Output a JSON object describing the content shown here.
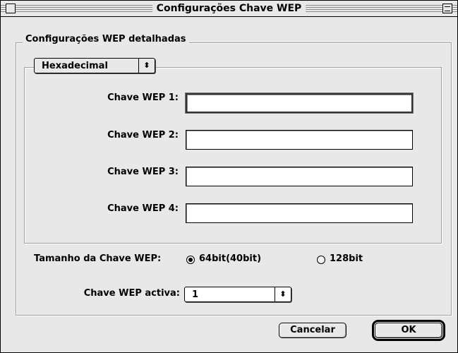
{
  "window": {
    "title": "Configurações Chave WEP"
  },
  "group": {
    "label": "Configurações WEP detalhadas"
  },
  "format_popup": {
    "value": "Hexadecimal",
    "arrow": "⬍"
  },
  "wep_keys": [
    {
      "label": "Chave WEP 1:",
      "value": ""
    },
    {
      "label": "Chave WEP 2:",
      "value": ""
    },
    {
      "label": "Chave WEP 3:",
      "value": ""
    },
    {
      "label": "Chave WEP 4:",
      "value": ""
    }
  ],
  "key_size": {
    "label": "Tamanho da Chave WEP:",
    "options": [
      {
        "label": "64bit(40bit)",
        "selected": true
      },
      {
        "label": "128bit",
        "selected": false
      }
    ]
  },
  "active_key": {
    "label": "Chave WEP activa:",
    "value": "1",
    "arrow": "⬍"
  },
  "buttons": {
    "cancel": "Cancelar",
    "ok": "OK"
  }
}
